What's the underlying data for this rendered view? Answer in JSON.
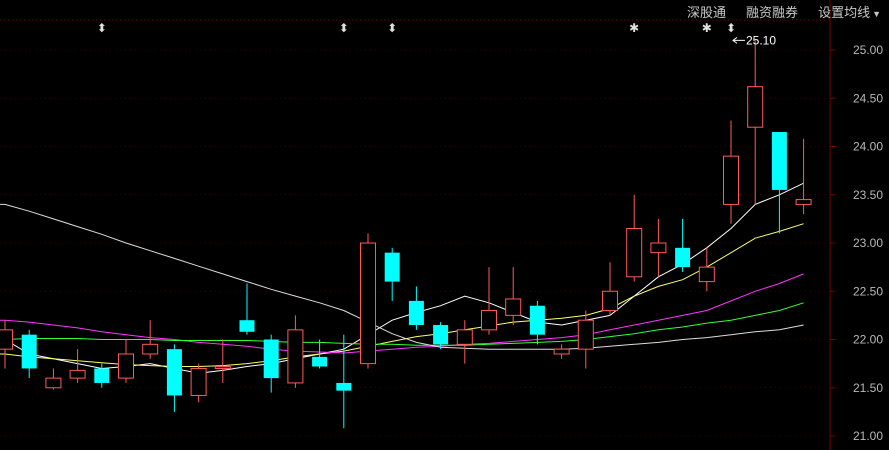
{
  "toolbar": {
    "shengutong": "深股通",
    "rongzi": "融资融券",
    "ma_settings": "设置均线"
  },
  "colors": {
    "background": "#000000",
    "up": "#ff5a5a",
    "down": "#00ffff",
    "ma5": "#ffffff",
    "ma10": "#ffff66",
    "ma20": "#ff33ff",
    "ma30": "#33ff33",
    "ma60": "#dddddd",
    "axis": "#b8b8b8",
    "grid": "#7a0000"
  },
  "chart_data": {
    "type": "candlestick",
    "ylim": [
      21.0,
      25.2
    ],
    "yticks": [
      "21.00",
      "21.50",
      "22.00",
      "22.50",
      "23.00",
      "23.50",
      "24.00",
      "24.50",
      "25.00"
    ],
    "annotation": {
      "label": "25.10",
      "price": 25.1,
      "candle_index": 30
    },
    "event_markers": [
      {
        "symbol": "⬍",
        "candle_index": 4
      },
      {
        "symbol": "⬍",
        "candle_index": 14
      },
      {
        "symbol": "⬍",
        "candle_index": 16
      },
      {
        "symbol": "✱",
        "candle_index": 26
      },
      {
        "symbol": "✱",
        "candle_index": 29
      },
      {
        "symbol": "⬍",
        "candle_index": 30
      }
    ],
    "candles": [
      {
        "o": 21.9,
        "h": 22.2,
        "l": 21.7,
        "c": 22.1
      },
      {
        "o": 22.05,
        "h": 22.1,
        "l": 21.6,
        "c": 21.7
      },
      {
        "o": 21.5,
        "h": 21.7,
        "l": 21.48,
        "c": 21.6
      },
      {
        "o": 21.6,
        "h": 21.9,
        "l": 21.55,
        "c": 21.68
      },
      {
        "o": 21.7,
        "h": 21.75,
        "l": 21.5,
        "c": 21.55
      },
      {
        "o": 21.6,
        "h": 22.0,
        "l": 21.55,
        "c": 21.85
      },
      {
        "o": 21.85,
        "h": 22.2,
        "l": 21.8,
        "c": 21.95
      },
      {
        "o": 21.9,
        "h": 21.95,
        "l": 21.25,
        "c": 21.42
      },
      {
        "o": 21.42,
        "h": 21.75,
        "l": 21.35,
        "c": 21.7
      },
      {
        "o": 21.7,
        "h": 22.0,
        "l": 21.55,
        "c": 21.72
      },
      {
        "o": 22.2,
        "h": 22.58,
        "l": 22.05,
        "c": 22.08
      },
      {
        "o": 22.0,
        "h": 22.05,
        "l": 21.45,
        "c": 21.6
      },
      {
        "o": 21.55,
        "h": 22.25,
        "l": 21.5,
        "c": 22.1
      },
      {
        "o": 21.82,
        "h": 22.0,
        "l": 21.7,
        "c": 21.72
      },
      {
        "o": 21.55,
        "h": 22.05,
        "l": 21.08,
        "c": 21.47
      },
      {
        "o": 21.75,
        "h": 23.1,
        "l": 21.7,
        "c": 23.0
      },
      {
        "o": 22.9,
        "h": 22.95,
        "l": 22.4,
        "c": 22.6
      },
      {
        "o": 22.4,
        "h": 22.55,
        "l": 22.1,
        "c": 22.15
      },
      {
        "o": 22.15,
        "h": 22.18,
        "l": 21.9,
        "c": 21.95
      },
      {
        "o": 21.95,
        "h": 22.2,
        "l": 21.75,
        "c": 22.1
      },
      {
        "o": 22.1,
        "h": 22.75,
        "l": 22.05,
        "c": 22.3
      },
      {
        "o": 22.25,
        "h": 22.75,
        "l": 22.15,
        "c": 22.42
      },
      {
        "o": 22.35,
        "h": 22.4,
        "l": 21.95,
        "c": 22.05
      },
      {
        "o": 21.85,
        "h": 21.95,
        "l": 21.8,
        "c": 21.9
      },
      {
        "o": 21.9,
        "h": 22.3,
        "l": 21.7,
        "c": 22.2
      },
      {
        "o": 22.3,
        "h": 22.8,
        "l": 22.25,
        "c": 22.5
      },
      {
        "o": 22.65,
        "h": 23.5,
        "l": 22.6,
        "c": 23.15
      },
      {
        "o": 22.9,
        "h": 23.25,
        "l": 22.65,
        "c": 23.0
      },
      {
        "o": 22.95,
        "h": 23.25,
        "l": 22.7,
        "c": 22.75
      },
      {
        "o": 22.6,
        "h": 22.95,
        "l": 22.5,
        "c": 22.75
      },
      {
        "o": 23.4,
        "h": 24.27,
        "l": 23.2,
        "c": 23.9
      },
      {
        "o": 24.2,
        "h": 25.1,
        "l": 23.4,
        "c": 24.62
      },
      {
        "o": 24.15,
        "h": 24.15,
        "l": 23.1,
        "c": 23.55
      },
      {
        "o": 23.4,
        "h": 24.08,
        "l": 23.3,
        "c": 23.45
      }
    ],
    "series": [
      {
        "key": "ma5",
        "values": [
          22.0,
          21.85,
          21.8,
          21.75,
          21.7,
          21.72,
          21.75,
          21.7,
          21.65,
          21.68,
          21.72,
          21.75,
          21.8,
          21.85,
          21.9,
          22.05,
          22.2,
          22.28,
          22.35,
          22.45,
          22.38,
          22.28,
          22.18,
          22.15,
          22.2,
          22.25,
          22.45,
          22.65,
          22.78,
          22.95,
          23.15,
          23.4,
          23.5,
          23.62
        ]
      },
      {
        "key": "ma10",
        "values": [
          21.85,
          21.82,
          21.8,
          21.78,
          21.76,
          21.74,
          21.73,
          21.72,
          21.72,
          21.73,
          21.75,
          21.78,
          21.82,
          21.85,
          21.88,
          21.93,
          21.98,
          22.03,
          22.06,
          22.1,
          22.14,
          22.18,
          22.2,
          22.22,
          22.25,
          22.32,
          22.45,
          22.55,
          22.62,
          22.75,
          22.9,
          23.05,
          23.12,
          23.2
        ]
      },
      {
        "key": "ma20",
        "values": [
          22.2,
          22.18,
          22.15,
          22.12,
          22.08,
          22.05,
          22.02,
          22.0,
          21.97,
          21.95,
          21.93,
          21.9,
          21.88,
          21.87,
          21.86,
          21.88,
          21.9,
          21.92,
          21.93,
          21.95,
          21.96,
          21.98,
          22.0,
          22.02,
          22.05,
          22.1,
          22.15,
          22.2,
          22.25,
          22.3,
          22.4,
          22.5,
          22.58,
          22.68
        ]
      },
      {
        "key": "ma30",
        "values": [
          22.0,
          22.01,
          22.01,
          22.01,
          22.0,
          22.0,
          22.0,
          21.99,
          21.99,
          21.99,
          21.99,
          21.98,
          21.97,
          21.97,
          21.96,
          21.95,
          21.95,
          21.94,
          21.94,
          21.94,
          21.95,
          21.96,
          21.97,
          21.98,
          22.0,
          22.03,
          22.06,
          22.1,
          22.13,
          22.17,
          22.2,
          22.25,
          22.3,
          22.38
        ]
      },
      {
        "key": "ma60",
        "values": [
          23.4,
          23.33,
          23.25,
          23.17,
          23.09,
          23.0,
          22.92,
          22.84,
          22.76,
          22.68,
          22.6,
          22.52,
          22.45,
          22.38,
          22.3,
          22.18,
          22.06,
          21.97,
          21.92,
          21.91,
          21.9,
          21.9,
          21.9,
          21.9,
          21.91,
          21.93,
          21.95,
          21.97,
          22.0,
          22.02,
          22.05,
          22.08,
          22.1,
          22.15
        ]
      }
    ]
  }
}
